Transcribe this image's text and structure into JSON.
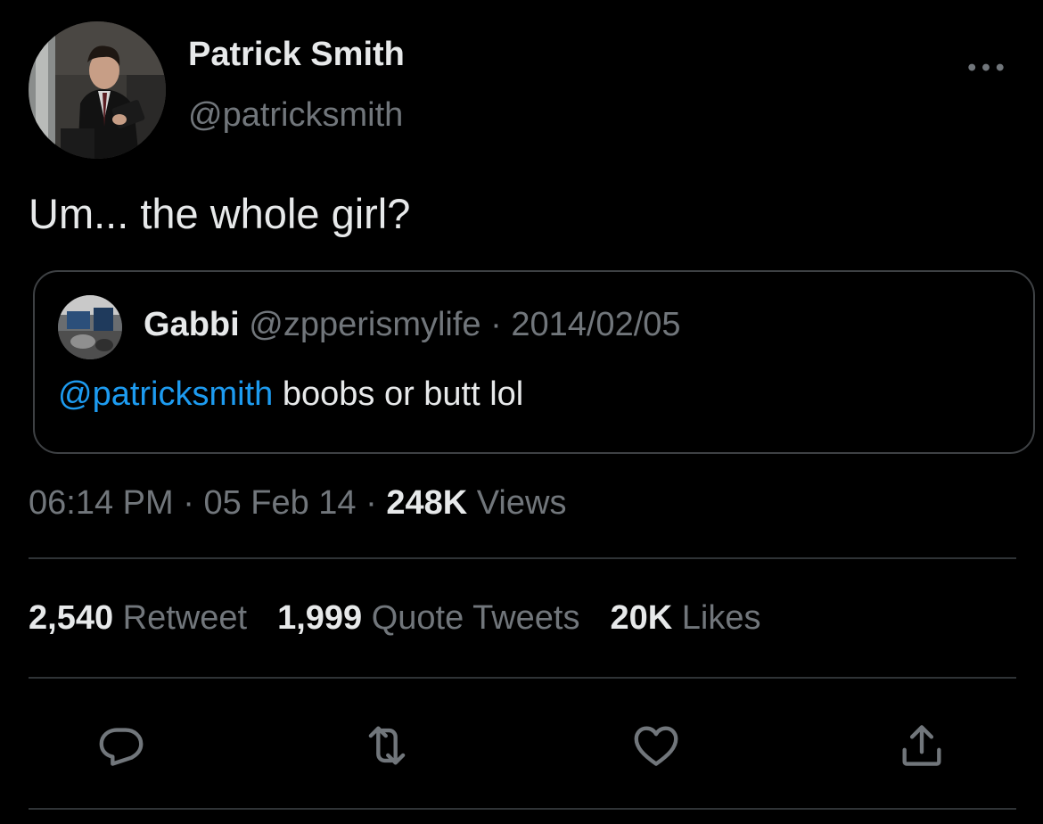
{
  "author": {
    "display_name": "Patrick Smith",
    "handle": "@patricksmith"
  },
  "tweet": {
    "text": "Um... the whole girl?"
  },
  "quoted_tweet": {
    "display_name": "Gabbi",
    "handle": "@zpperismylife",
    "separator": "·",
    "date": "2014/02/05",
    "mention": "@patricksmith",
    "text": " boobs or butt lol"
  },
  "meta": {
    "time": "06:14 PM",
    "separator1": " · ",
    "date": "05 Feb 14",
    "separator2": " · ",
    "views_count": "248K",
    "views_label": " Views"
  },
  "stats": {
    "retweets_count": "2,540",
    "retweets_label": " Retweet",
    "quotes_count": "1,999",
    "quotes_label": " Quote Tweets",
    "likes_count": "20K",
    "likes_label": " Likes"
  },
  "icons": {
    "more": "more-horizontal-icon",
    "reply": "reply-icon",
    "retweet": "retweet-icon",
    "like": "heart-icon",
    "share": "share-icon"
  },
  "colors": {
    "background": "#000000",
    "primary_text": "#e7e9ea",
    "secondary_text": "#71767b",
    "accent": "#1d9bf0",
    "border": "#2f3336"
  }
}
